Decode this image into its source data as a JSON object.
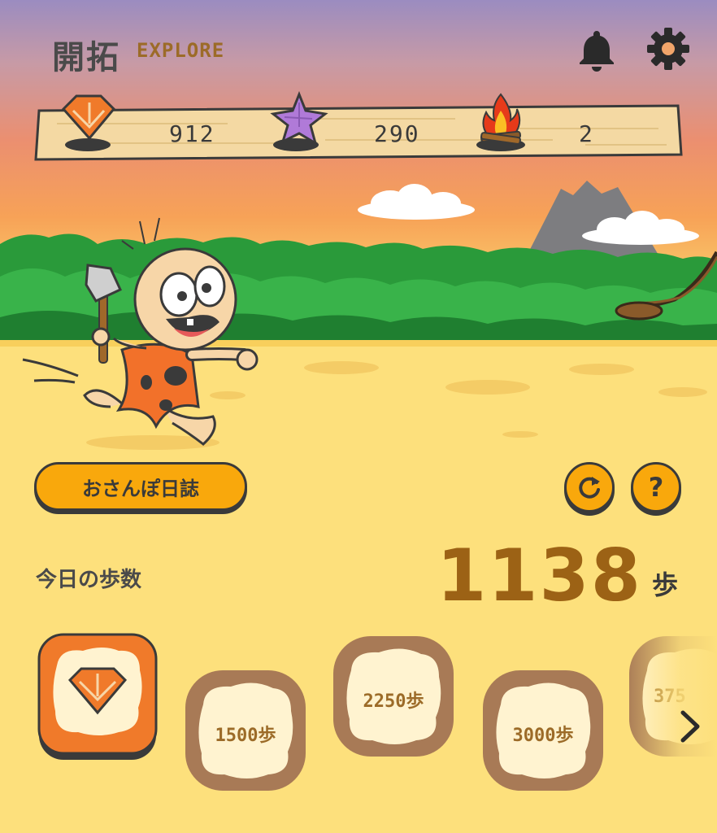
{
  "header": {
    "title": "開拓",
    "subtitle": "EXPLORE",
    "bell_icon": "bell-icon",
    "settings_icon": "gear-icon"
  },
  "resources": [
    {
      "icon": "orange-gem-icon",
      "value": "912"
    },
    {
      "icon": "purple-star-icon",
      "value": "290"
    },
    {
      "icon": "campfire-icon",
      "value": "2"
    }
  ],
  "controls": {
    "diary_label": "おさんぽ日誌",
    "refresh_icon": "refresh-icon",
    "help_label": "?"
  },
  "steps": {
    "label": "今日の歩数",
    "count": "1138",
    "unit": "歩"
  },
  "milestones": [
    {
      "label": "",
      "icon": "gem-icon",
      "state": "achieved"
    },
    {
      "label": "1500歩",
      "state": "locked"
    },
    {
      "label": "2250歩",
      "state": "locked"
    },
    {
      "label": "3000歩",
      "state": "locked"
    },
    {
      "label": "375",
      "state": "locked"
    }
  ],
  "colors": {
    "accent": "#f9a80c",
    "gem_orange": "#f07a2a",
    "star_purple": "#b07ad8",
    "steps_brown": "#9c6215",
    "ground": "#fde07c"
  }
}
